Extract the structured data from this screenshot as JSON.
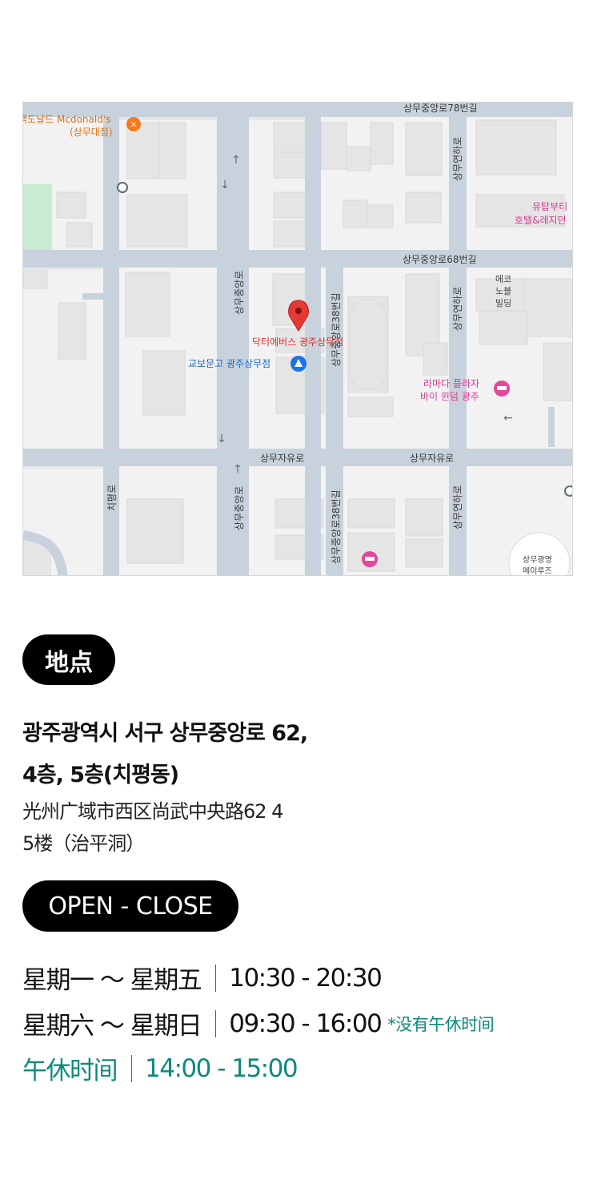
{
  "map": {
    "roads": {
      "sangmu_78": "상무중앙로78번길",
      "sangmu_68": "상무중앙로68번길",
      "sangmu_jayu_left": "상무자유로",
      "sangmu_jayu_right": "상무자유로",
      "sangmu_jungang_top": "상무중앙로",
      "sangmu_jungang_bottom": "상무중앙로",
      "sangmu_yeonha_top": "상무연하로",
      "sangmu_yeonha_mid": "상무연하로",
      "sangmu_yeonha_bottom": "상무연하로",
      "sangmu_38_top": "상무중앙로38번길",
      "sangmu_38_bottom": "상무중앙로38번길",
      "chipyeong": "치평로"
    },
    "pois": {
      "mcdonalds_line1": "맥도날드 Mcdonald's",
      "mcdonalds_line2": "(상무대점)",
      "yutop_line1": "유탑부티",
      "yutop_line2": "호텔&레지던",
      "eco_line1": "에코",
      "eco_line2": "노블",
      "eco_line3": "빌딩",
      "marker_label": "닥터에버스 광주상무점",
      "kyobo": "교보문고 광주상무점",
      "ramada_line1": "라마다 플라자",
      "ramada_line2": "바이 윈덤 광주",
      "sangmu_gwangmyeong_line1": "상무광명",
      "sangmu_gwangmyeong_line2": "메이루즈"
    }
  },
  "location": {
    "badge": "地点",
    "address_ko_line1": "광주광역시 서구 상무중앙로 62,",
    "address_ko_line2": "4층, 5층(치평동)",
    "address_cn_line1": "光州广域市西区尚武中央路62 4",
    "address_cn_line2": "5楼（治平洞）"
  },
  "hours": {
    "badge": "OPEN - CLOSE",
    "weekday_days": "星期一 ～ 星期五",
    "weekday_time": "10:30 - 20:30",
    "weekend_days": "星期六 ～ 星期日",
    "weekend_time": "09:30 - 16:00",
    "weekend_note": "*没有午休时间",
    "lunch_label": "午休时间",
    "lunch_time": "14:00 - 15:00"
  },
  "colors": {
    "teal": "#0b8a7a",
    "marker_red": "#e53935",
    "poi_pink": "#e1489a",
    "poi_blue": "#1a73e8",
    "poi_orange": "#f4791f"
  }
}
